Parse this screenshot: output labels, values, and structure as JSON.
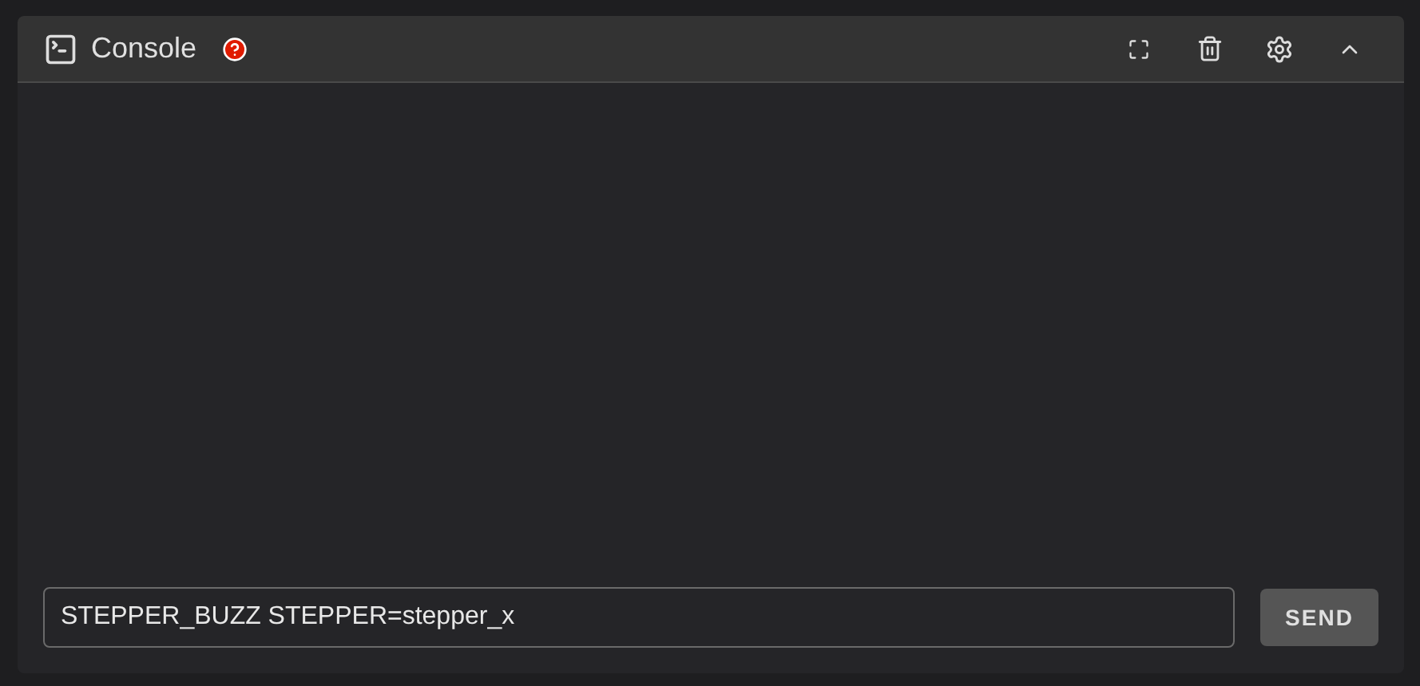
{
  "panel": {
    "title": "Console"
  },
  "command": {
    "value": "STEPPER_BUZZ STEPPER=stepper_x"
  },
  "send_button": {
    "label": "SEND"
  }
}
